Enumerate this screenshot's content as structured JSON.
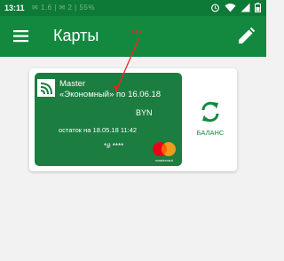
{
  "status_bar": {
    "time": "13:11",
    "notification_text": "✉ 1.6 | ✉ 2 | 55%",
    "icons": [
      "alarm-icon",
      "wifi-icon",
      "signal-icon",
      "battery-icon"
    ]
  },
  "app_bar": {
    "title": "Карты",
    "menu_icon": "menu-icon",
    "edit_icon": "pencil-icon",
    "annotation_text": "***"
  },
  "card": {
    "name": "Master",
    "description": "«Экономный» по 16.06.18",
    "currency": "BYN",
    "balance_date": "остаток на 18.05.18 11:42",
    "number": "*# ****",
    "brand_caption": "mastercard",
    "brand_icon": "mastercard-logo",
    "logo_icon": "contactless-icon"
  },
  "balance_button": {
    "label": "БАЛАНС",
    "icon": "refresh-icon"
  },
  "colors": {
    "accent": "#13893f",
    "status_bar": "#0e7a37",
    "card": "#1c7d40",
    "annotation": "#ff1f1f"
  }
}
